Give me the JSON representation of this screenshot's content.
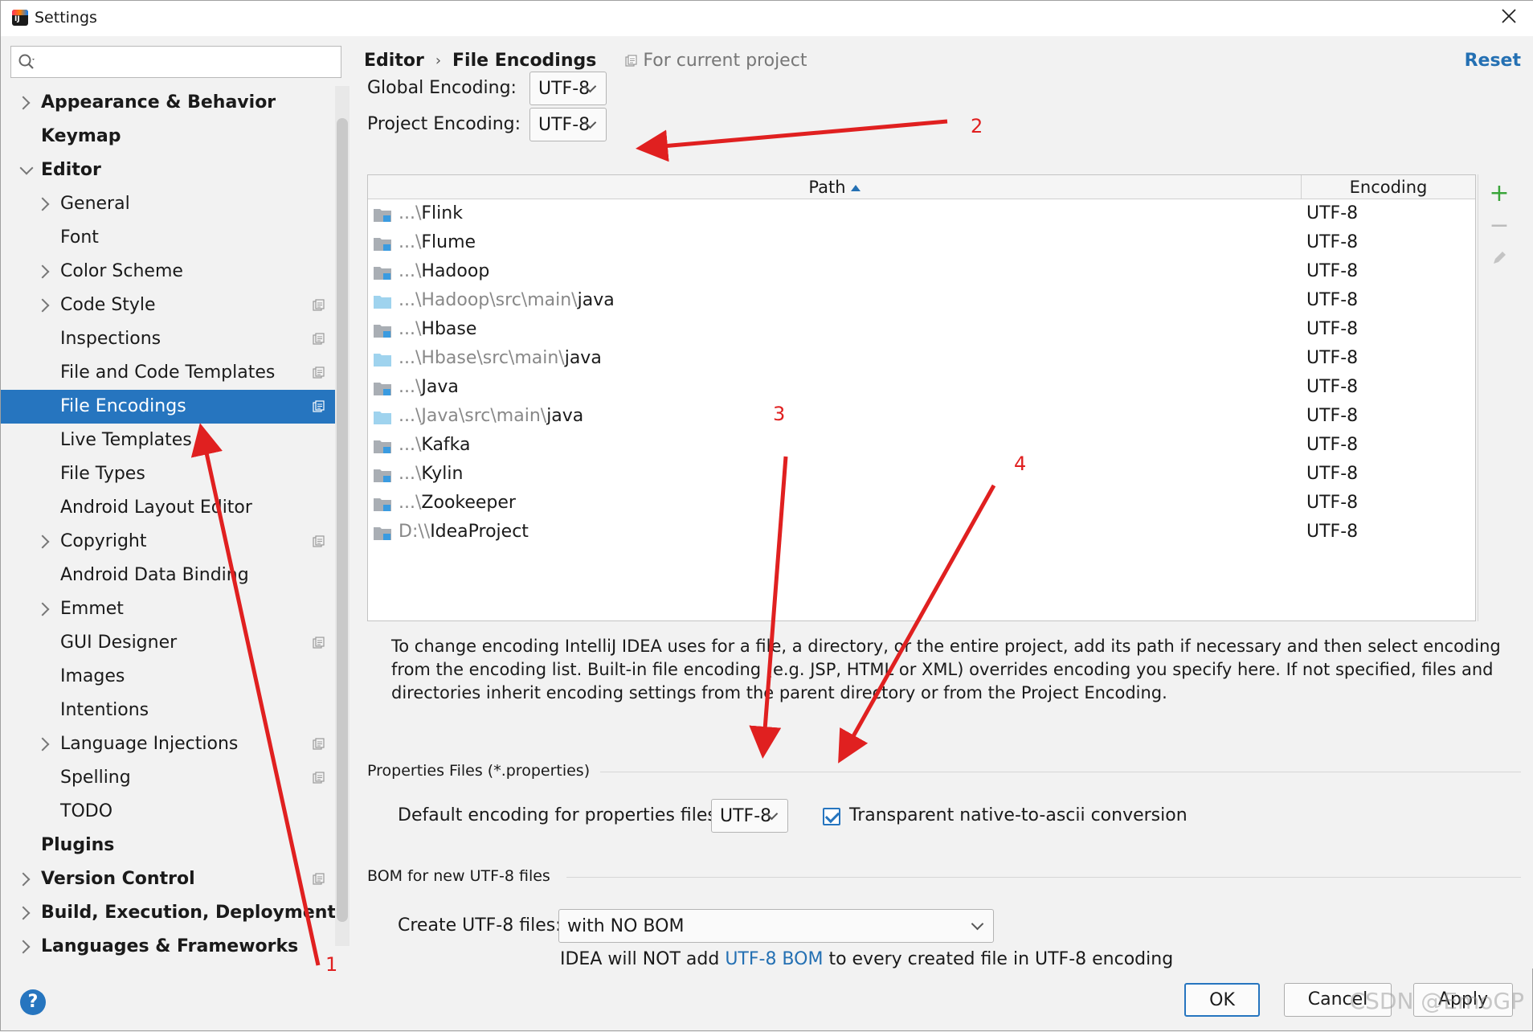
{
  "window": {
    "title": "Settings"
  },
  "search": {
    "placeholder": ""
  },
  "sidebar": {
    "items": [
      {
        "label": "Appearance & Behavior",
        "bold": true,
        "expander": "right",
        "indent": 0,
        "project": false
      },
      {
        "label": "Keymap",
        "bold": true,
        "expander": "none",
        "indent": 0,
        "project": false
      },
      {
        "label": "Editor",
        "bold": true,
        "expander": "down",
        "indent": 0,
        "project": false
      },
      {
        "label": "General",
        "bold": false,
        "expander": "right",
        "indent": 1,
        "project": false
      },
      {
        "label": "Font",
        "bold": false,
        "expander": "none",
        "indent": 1,
        "project": false
      },
      {
        "label": "Color Scheme",
        "bold": false,
        "expander": "right",
        "indent": 1,
        "project": false
      },
      {
        "label": "Code Style",
        "bold": false,
        "expander": "right",
        "indent": 1,
        "project": true
      },
      {
        "label": "Inspections",
        "bold": false,
        "expander": "none",
        "indent": 1,
        "project": true
      },
      {
        "label": "File and Code Templates",
        "bold": false,
        "expander": "none",
        "indent": 1,
        "project": true
      },
      {
        "label": "File Encodings",
        "bold": false,
        "expander": "none",
        "indent": 1,
        "project": true,
        "selected": true
      },
      {
        "label": "Live Templates",
        "bold": false,
        "expander": "none",
        "indent": 1,
        "project": false
      },
      {
        "label": "File Types",
        "bold": false,
        "expander": "none",
        "indent": 1,
        "project": false
      },
      {
        "label": "Android Layout Editor",
        "bold": false,
        "expander": "none",
        "indent": 1,
        "project": false
      },
      {
        "label": "Copyright",
        "bold": false,
        "expander": "right",
        "indent": 1,
        "project": true
      },
      {
        "label": "Android Data Binding",
        "bold": false,
        "expander": "none",
        "indent": 1,
        "project": false
      },
      {
        "label": "Emmet",
        "bold": false,
        "expander": "right",
        "indent": 1,
        "project": false
      },
      {
        "label": "GUI Designer",
        "bold": false,
        "expander": "none",
        "indent": 1,
        "project": true
      },
      {
        "label": "Images",
        "bold": false,
        "expander": "none",
        "indent": 1,
        "project": false
      },
      {
        "label": "Intentions",
        "bold": false,
        "expander": "none",
        "indent": 1,
        "project": false
      },
      {
        "label": "Language Injections",
        "bold": false,
        "expander": "right",
        "indent": 1,
        "project": true
      },
      {
        "label": "Spelling",
        "bold": false,
        "expander": "none",
        "indent": 1,
        "project": true
      },
      {
        "label": "TODO",
        "bold": false,
        "expander": "none",
        "indent": 1,
        "project": false
      },
      {
        "label": "Plugins",
        "bold": true,
        "expander": "none",
        "indent": 0,
        "project": false
      },
      {
        "label": "Version Control",
        "bold": true,
        "expander": "right",
        "indent": 0,
        "project": true
      },
      {
        "label": "Build, Execution, Deployment",
        "bold": true,
        "expander": "right",
        "indent": 0,
        "project": false
      },
      {
        "label": "Languages & Frameworks",
        "bold": true,
        "expander": "right",
        "indent": 0,
        "project": false
      }
    ]
  },
  "breadcrumb": {
    "part1": "Editor",
    "separator": "›",
    "part2": "File Encodings",
    "scope": "For current project"
  },
  "reset_label": "Reset",
  "global_encoding": {
    "label": "Global Encoding:",
    "value": "UTF-8"
  },
  "project_encoding": {
    "label": "Project Encoding:",
    "value": "UTF-8"
  },
  "table": {
    "col_path": "Path",
    "col_encoding": "Encoding",
    "rows": [
      {
        "dim": "...\\",
        "path": "Flink",
        "encoding": "UTF-8",
        "type": "module"
      },
      {
        "dim": "...\\",
        "path": "Flume",
        "encoding": "UTF-8",
        "type": "module"
      },
      {
        "dim": "...\\",
        "path": "Hadoop",
        "encoding": "UTF-8",
        "type": "module"
      },
      {
        "dim": "...\\Hadoop\\src\\main\\",
        "path": "java",
        "encoding": "UTF-8",
        "type": "source"
      },
      {
        "dim": "...\\",
        "path": "Hbase",
        "encoding": "UTF-8",
        "type": "module"
      },
      {
        "dim": "...\\Hbase\\src\\main\\",
        "path": "java",
        "encoding": "UTF-8",
        "type": "source"
      },
      {
        "dim": "...\\",
        "path": "Java",
        "encoding": "UTF-8",
        "type": "module"
      },
      {
        "dim": "...\\Java\\src\\main\\",
        "path": "java",
        "encoding": "UTF-8",
        "type": "source"
      },
      {
        "dim": "...\\",
        "path": "Kafka",
        "encoding": "UTF-8",
        "type": "module"
      },
      {
        "dim": "...\\",
        "path": "Kylin",
        "encoding": "UTF-8",
        "type": "module"
      },
      {
        "dim": "...\\",
        "path": "Zookeeper",
        "encoding": "UTF-8",
        "type": "module"
      },
      {
        "dim": "D:\\\\",
        "path": "IdeaProject",
        "encoding": "UTF-8",
        "type": "module"
      }
    ]
  },
  "table_actions": {
    "add": "+",
    "remove": "−"
  },
  "info_text": "To change encoding IntelliJ IDEA uses for a file, a directory, or the entire project, add its path if necessary and then select encoding from the encoding list. Built-in file encoding (e.g. JSP, HTML or XML) overrides encoding you specify here. If not specified, files and directories inherit encoding settings from the parent directory or from the Project Encoding.",
  "properties": {
    "section_title": "Properties Files (*.properties)",
    "default_label": "Default encoding for properties files:",
    "default_value": "UTF-8",
    "transparent_label": "Transparent native-to-ascii conversion",
    "transparent_checked": true
  },
  "bom": {
    "section_title": "BOM for new UTF-8 files",
    "create_label": "Create UTF-8 files:",
    "create_value": "with NO BOM",
    "note_pre": "IDEA will NOT add ",
    "note_link": "UTF-8 BOM",
    "note_post": " to every created file in UTF-8 encoding"
  },
  "buttons": {
    "ok": "OK",
    "cancel": "Cancel",
    "apply": "Apply",
    "help": "?"
  },
  "watermark": "CSDN @EmoGP",
  "annotations": {
    "n1": "1",
    "n2": "2",
    "n3": "3",
    "n4": "4",
    "color": "#e02020"
  },
  "colors": {
    "selection": "#2675bf",
    "link": "#2470b3",
    "add_green": "#3aa53a"
  }
}
